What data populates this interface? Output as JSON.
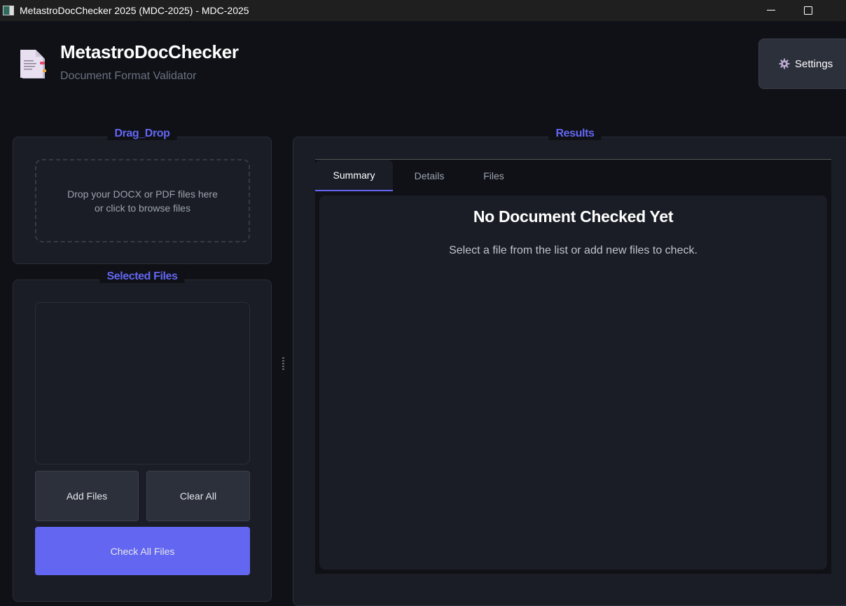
{
  "window": {
    "title": "MetastroDocChecker 2025 (MDC-2025) - MDC-2025"
  },
  "header": {
    "app_name": "MetastroDocChecker",
    "subtitle": "Document Format Validator",
    "settings_label": "Settings",
    "settings_icon": "gear-icon"
  },
  "drag_drop": {
    "legend": "Drag_Drop",
    "line1": "Drop your DOCX or PDF files here",
    "line2": "or click to browse files"
  },
  "selected_files": {
    "legend": "Selected Files",
    "add_label": "Add Files",
    "clear_label": "Clear All",
    "check_label": "Check All Files"
  },
  "results": {
    "legend": "Results",
    "tabs": [
      {
        "label": "Summary"
      },
      {
        "label": "Details"
      },
      {
        "label": "Files"
      }
    ],
    "empty_title": "No Document Checked Yet",
    "empty_message": "Select a file from the list or add new files to check."
  },
  "colors": {
    "accent": "#6366f1",
    "background": "#0f1116",
    "panel": "#1a1d25"
  }
}
